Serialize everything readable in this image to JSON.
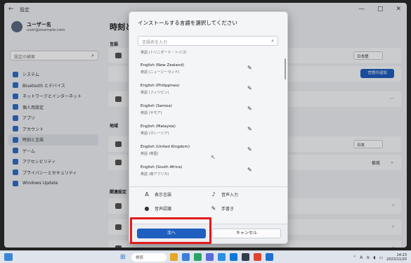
{
  "window": {
    "app_name": "設定",
    "back_icon": "back-arrow-icon",
    "controls": [
      "—",
      "□",
      "✕"
    ]
  },
  "sidebar": {
    "user_name": "ユーザー名",
    "user_email": "user@example.com",
    "search_placeholder": "設定の検索",
    "items": [
      {
        "label": "システム",
        "icon": "system-icon"
      },
      {
        "label": "Bluetooth とデバイス",
        "icon": "bluetooth-icon"
      },
      {
        "label": "ネットワークとインターネット",
        "icon": "network-icon"
      },
      {
        "label": "個人用設定",
        "icon": "personalize-icon"
      },
      {
        "label": "アプリ",
        "icon": "apps-icon"
      },
      {
        "label": "アカウント",
        "icon": "account-icon"
      },
      {
        "label": "時刻と言語",
        "icon": "time-language-icon"
      },
      {
        "label": "ゲーム",
        "icon": "gaming-icon"
      },
      {
        "label": "アクセシビリティ",
        "icon": "accessibility-icon"
      },
      {
        "label": "プライバシーとセキュリティ",
        "icon": "privacy-icon"
      },
      {
        "label": "Windows Update",
        "icon": "update-icon"
      }
    ],
    "active_index": 6
  },
  "content": {
    "title": "時刻と言語",
    "section1": "言語",
    "row_display_value": "日本語",
    "add_language_label": "言語の追加",
    "section2": "地域",
    "region_value": "日本",
    "format_value": "推奨",
    "section3": "関連設定"
  },
  "dialog": {
    "title": "インストールする言語を選択してください",
    "search_placeholder": "言語名を入力",
    "partial_top": "英語 (トリニダード・トバゴ)",
    "languages": [
      {
        "name": "English (New Zealand)",
        "native": "英語 (ニュージーランド)"
      },
      {
        "name": "English (Philippines)",
        "native": "英語 (フィリピン)"
      },
      {
        "name": "English (Samoa)",
        "native": "英語 (サモア)"
      },
      {
        "name": "English (Malaysia)",
        "native": "英語 (マレーシア)"
      },
      {
        "name": "English (United Kingdom)",
        "native": "英語 (英国)"
      },
      {
        "name": "English (South Africa)",
        "native": "英語 (南アフリカ)"
      }
    ],
    "features": [
      {
        "label": "表示言語",
        "icon": "display-language-icon"
      },
      {
        "label": "音声入力",
        "icon": "speech-icon"
      },
      {
        "label": "音声認識",
        "icon": "voice-icon"
      },
      {
        "label": "手書き",
        "icon": "handwriting-icon"
      }
    ],
    "next_label": "次へ",
    "cancel_label": "キャンセル"
  },
  "taskbar": {
    "search_placeholder": "検索",
    "app_colors": [
      "#e4a72a",
      "#3a7fd5",
      "#29a36a",
      "#5a6ad8",
      "#2b8ee0",
      "#0f78d4",
      "#333d4b",
      "#e0442f",
      "#1f6fd0"
    ],
    "time": "14:23",
    "date": "2023/11/20"
  },
  "colors": {
    "accent": "#1f5fbf",
    "highlight": "#e01b1b"
  }
}
